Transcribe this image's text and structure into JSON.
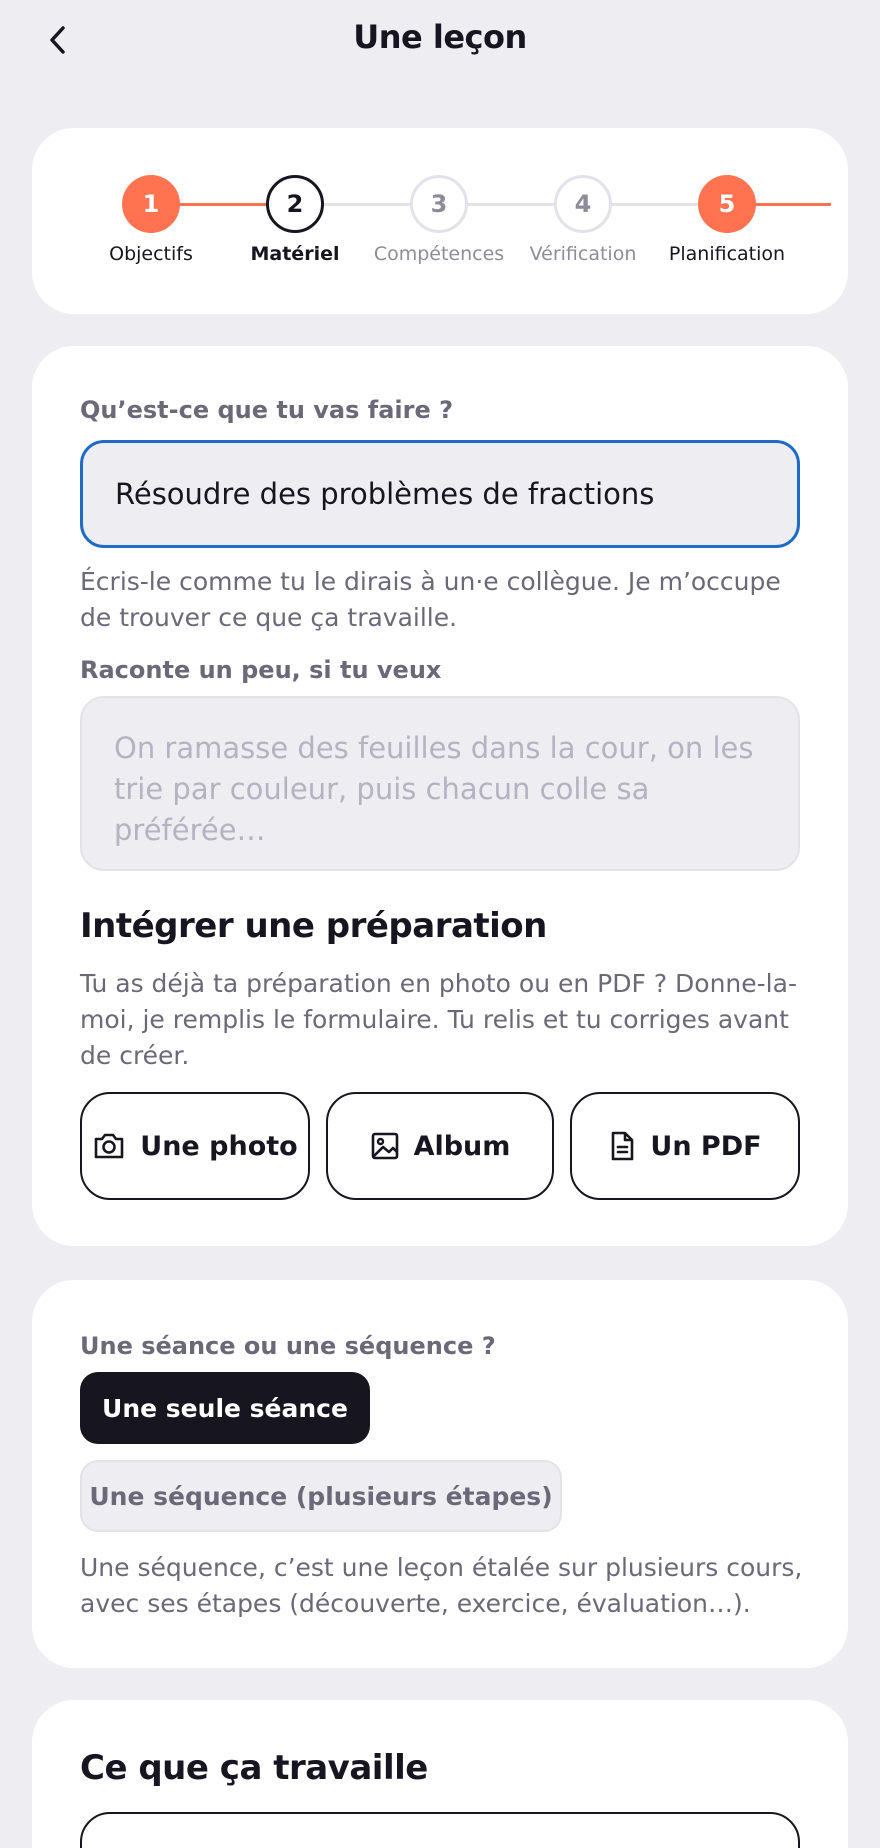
{
  "header": {
    "title": "Une leçon",
    "back_icon": "chevron-left-icon"
  },
  "stepper": {
    "steps": [
      {
        "number": "1",
        "label": "Objectifs",
        "state": "done"
      },
      {
        "number": "2",
        "label": "Matériel",
        "state": "current"
      },
      {
        "number": "3",
        "label": "Compétences",
        "state": "todo"
      },
      {
        "number": "4",
        "label": "Vérification",
        "state": "todo"
      },
      {
        "number": "5",
        "label": "Planification",
        "state": "done"
      }
    ],
    "accent_color": "#ff7350"
  },
  "form": {
    "activity_label": "Qu’est-ce que tu vas faire ?",
    "activity_value": "Résoudre des problèmes de fractions",
    "activity_helper": "Écris-le comme tu le dirais à un·e collègue. Je m’occupe de trouver ce que ça travaille.",
    "story_label": "Raconte un peu, si tu veux",
    "story_placeholder": "On ramasse des feuilles dans la cour, on les trie par couleur, puis chacun colle sa préférée…",
    "import_title": "Intégrer une préparation",
    "import_helper": "Tu as déjà ta préparation en photo ou en PDF ? Donne-la-moi, je remplis le formulaire. Tu relis et tu corriges avant de créer.",
    "import_buttons": [
      {
        "label": "Une photo",
        "icon": "camera-icon"
      },
      {
        "label": "Album",
        "icon": "image-icon"
      },
      {
        "label": "Un PDF",
        "icon": "document-icon"
      }
    ]
  },
  "mode": {
    "label": "Une séance ou une séquence ?",
    "options": [
      {
        "label": "Une seule séance",
        "selected": true
      },
      {
        "label": "Une séquence (plusieurs étapes)",
        "selected": false
      }
    ],
    "helper": "Une séquence, c’est une leçon étalée sur plusieurs cours, avec ses étapes (découverte, exercice, évaluation…)."
  },
  "work": {
    "title": "Ce que ça travaille"
  },
  "colors": {
    "background": "#eeedf2",
    "text": "#17151f",
    "muted": "#6b6878",
    "focus_border": "#1f6cc7"
  }
}
